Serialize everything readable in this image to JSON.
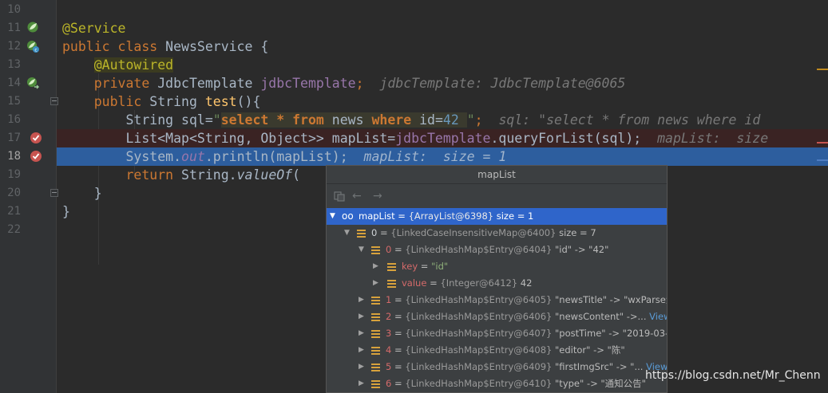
{
  "editor": {
    "line_numbers": [
      "10",
      "11",
      "12",
      "13",
      "14",
      "15",
      "16",
      "17",
      "18",
      "19",
      "20",
      "21",
      "22"
    ],
    "lines": {
      "l11": {
        "annotation": "@Service"
      },
      "l12": {
        "kw1": "public",
        "kw2": "class",
        "name": " NewsService {"
      },
      "l13": {
        "annotation": "@Autowired"
      },
      "l14": {
        "kw": "private",
        "type": " JdbcTemplate ",
        "field": "jdbcTemplate",
        "semi": ";",
        "hint": "  jdbcTemplate: JdbcTemplate@6065"
      },
      "l15": {
        "kw": "public",
        "type": " String ",
        "method": "test",
        "rest": "(){"
      },
      "l16": {
        "pre": "String sql=",
        "q1": "\"",
        "s1": "select",
        "s2": " * ",
        "s3": "from",
        "s4": " news ",
        "s5": "where",
        "s6": " id=",
        "s7": "42",
        "s8": " ",
        "q2": "\"",
        "semi": ";",
        "hint": "  sql: \"select * from news where id"
      },
      "l17": {
        "pre": "List<Map<String, Object>> mapList=",
        "field": "jdbcTemplate",
        "call": ".queryForList(sql);",
        "hint": "  mapList:  size"
      },
      "l18": {
        "pre": "System.",
        "field": "out",
        "call": ".println(mapList);",
        "hint": "  mapList:  size = 1"
      },
      "l19": {
        "kw": "return",
        "pre": " String.",
        "method": "valueOf",
        "rest": "("
      },
      "l20": {
        "text": "}"
      },
      "l21": {
        "text": "}"
      }
    }
  },
  "popup": {
    "title": "mapList",
    "toolbar": {
      "back": "←",
      "forward": "→"
    },
    "rows": [
      {
        "name": "mapList",
        "eq": " = ",
        "type": "{ArrayList@6398}",
        "val": "  size = 1"
      },
      {
        "name": "0",
        "eq": " = ",
        "type": "{LinkedCaseInsensitiveMap@6400}",
        "val": "  size = 7"
      },
      {
        "name": "0",
        "eq": " = ",
        "type": "{LinkedHashMap$Entry@6404}",
        "val": " \"id\" -> \"42\""
      },
      {
        "name": "key",
        "eq": " = ",
        "type": "",
        "val": "\"id\""
      },
      {
        "name": "value",
        "eq": " = ",
        "type": "{Integer@6412}",
        "val": " 42"
      },
      {
        "name": "1",
        "eq": " = ",
        "type": "{LinkedHashMap$Entry@6405}",
        "val": " \"newsTitle\" -> \"wxParse测"
      },
      {
        "name": "2",
        "eq": " = ",
        "type": "{LinkedHashMap$Entry@6406}",
        "val": " \"newsContent\" ->... ",
        "link": "View"
      },
      {
        "name": "3",
        "eq": " = ",
        "type": "{LinkedHashMap$Entry@6407}",
        "val": " \"postTime\" -> \"2019-03-"
      },
      {
        "name": "4",
        "eq": " = ",
        "type": "{LinkedHashMap$Entry@6408}",
        "val": " \"editor\" -> \"陈\""
      },
      {
        "name": "5",
        "eq": " = ",
        "type": "{LinkedHashMap$Entry@6409}",
        "val": " \"firstImgSrc\" -> \"... ",
        "link": "View"
      },
      {
        "name": "6",
        "eq": " = ",
        "type": "{LinkedHashMap$Entry@6410}",
        "val": " \"type\" -> \"通知公告\""
      }
    ]
  },
  "watermark": "https://blog.csdn.net/Mr_Chenn",
  "colors": {
    "keyword": "#cc7832",
    "annotation": "#bbb529",
    "selection": "#2f65ca",
    "current_line": "#2d5e9e"
  }
}
